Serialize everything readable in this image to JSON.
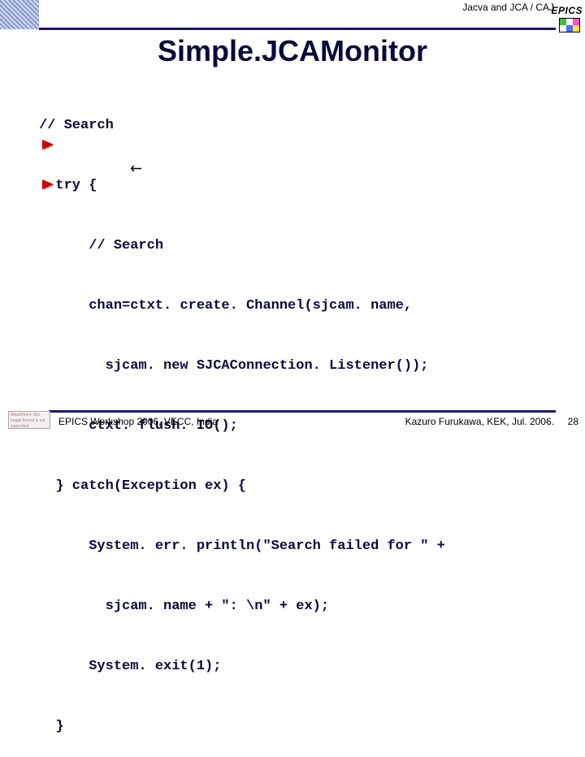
{
  "header": {
    "breadcrumb": "Jacva and JCA / CAJ",
    "brand": "EPICS"
  },
  "title": "Simple.JCAMonitor",
  "code": {
    "lines": [
      "// Search",
      "  try {",
      "      // Search",
      "      chan=ctxt. create. Channel(sjcam. name,",
      "        sjcam. new SJCAConnection. Listener());",
      "      ctxt. flush. IO();",
      "  } catch(Exception ex) {",
      "      System. err. println(\"Search failed for \" +",
      "        sjcam. name + \": \\n\" + ex);",
      "      System. exit(1);",
      "  }"
    ]
  },
  "footer": {
    "placeholder": "Attachment: this image format is not supported",
    "left_text": "EPICS Workshop 2006, VECC, India",
    "right_text": "Kazuro Furukawa, KEK, Jul. 2006.",
    "page_number": "28"
  },
  "epics_colors": [
    "#3bbf3b",
    "#ffffff",
    "#ff4fcf",
    "#ffffff",
    "#4f6fff",
    "#ffe23b"
  ]
}
